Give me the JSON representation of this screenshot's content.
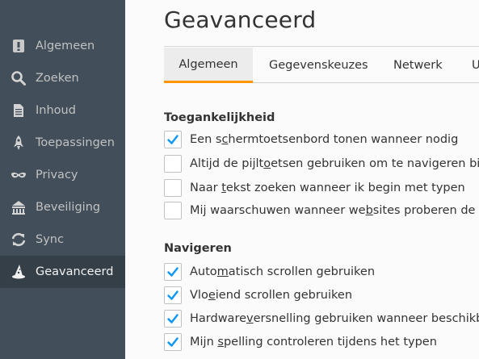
{
  "sidebar": {
    "items": [
      {
        "label": "Algemeen",
        "icon": "general-icon",
        "selected": false
      },
      {
        "label": "Zoeken",
        "icon": "search-icon",
        "selected": false
      },
      {
        "label": "Inhoud",
        "icon": "document-icon",
        "selected": false
      },
      {
        "label": "Toepassingen",
        "icon": "rocket-icon",
        "selected": false
      },
      {
        "label": "Privacy",
        "icon": "mask-icon",
        "selected": false
      },
      {
        "label": "Beveiliging",
        "icon": "castle-icon",
        "selected": false
      },
      {
        "label": "Sync",
        "icon": "sync-icon",
        "selected": false
      },
      {
        "label": "Geavanceerd",
        "icon": "wizard-hat-icon",
        "selected": true
      }
    ]
  },
  "main": {
    "title": "Geavanceerd",
    "tabs": [
      {
        "label": "Algemeen",
        "selected": true
      },
      {
        "label": "Gegevenskeuzes",
        "selected": false
      },
      {
        "label": "Netwerk",
        "selected": false
      },
      {
        "label": "U",
        "selected": false
      }
    ],
    "sections": [
      {
        "title": "Toegankelijkheid",
        "options": [
          {
            "pre": "Een s",
            "key": "c",
            "post": "hermtoetsenbord tonen wanneer nodig",
            "checked": true
          },
          {
            "pre": "Altijd de pijlt",
            "key": "o",
            "post": "etsen gebruiken om te navigeren binner",
            "checked": false
          },
          {
            "pre": "Naar ",
            "key": "t",
            "post": "ekst zoeken wanneer ik begin met typen",
            "checked": false
          },
          {
            "pre": "Mij waarschuwen wanneer we",
            "key": "b",
            "post": "sites proberen de pagir",
            "checked": false
          }
        ]
      },
      {
        "title": "Navigeren",
        "options": [
          {
            "pre": "Auto",
            "key": "m",
            "post": "atisch scrollen gebruiken",
            "checked": true
          },
          {
            "pre": "Vlo",
            "key": "e",
            "post": "iend scrollen gebruiken",
            "checked": true
          },
          {
            "pre": "Hardware",
            "key": "v",
            "post": "ersnelling gebruiken wanneer beschikbaar",
            "checked": true
          },
          {
            "pre": "Mijn ",
            "key": "s",
            "post": "pelling controleren tijdens het typen",
            "checked": true
          }
        ]
      }
    ]
  },
  "colors": {
    "sidebar_bg": "#424f5a",
    "sidebar_selected_bg": "#343f48",
    "accent": "#ff9500",
    "checkmark": "#0996f8"
  }
}
